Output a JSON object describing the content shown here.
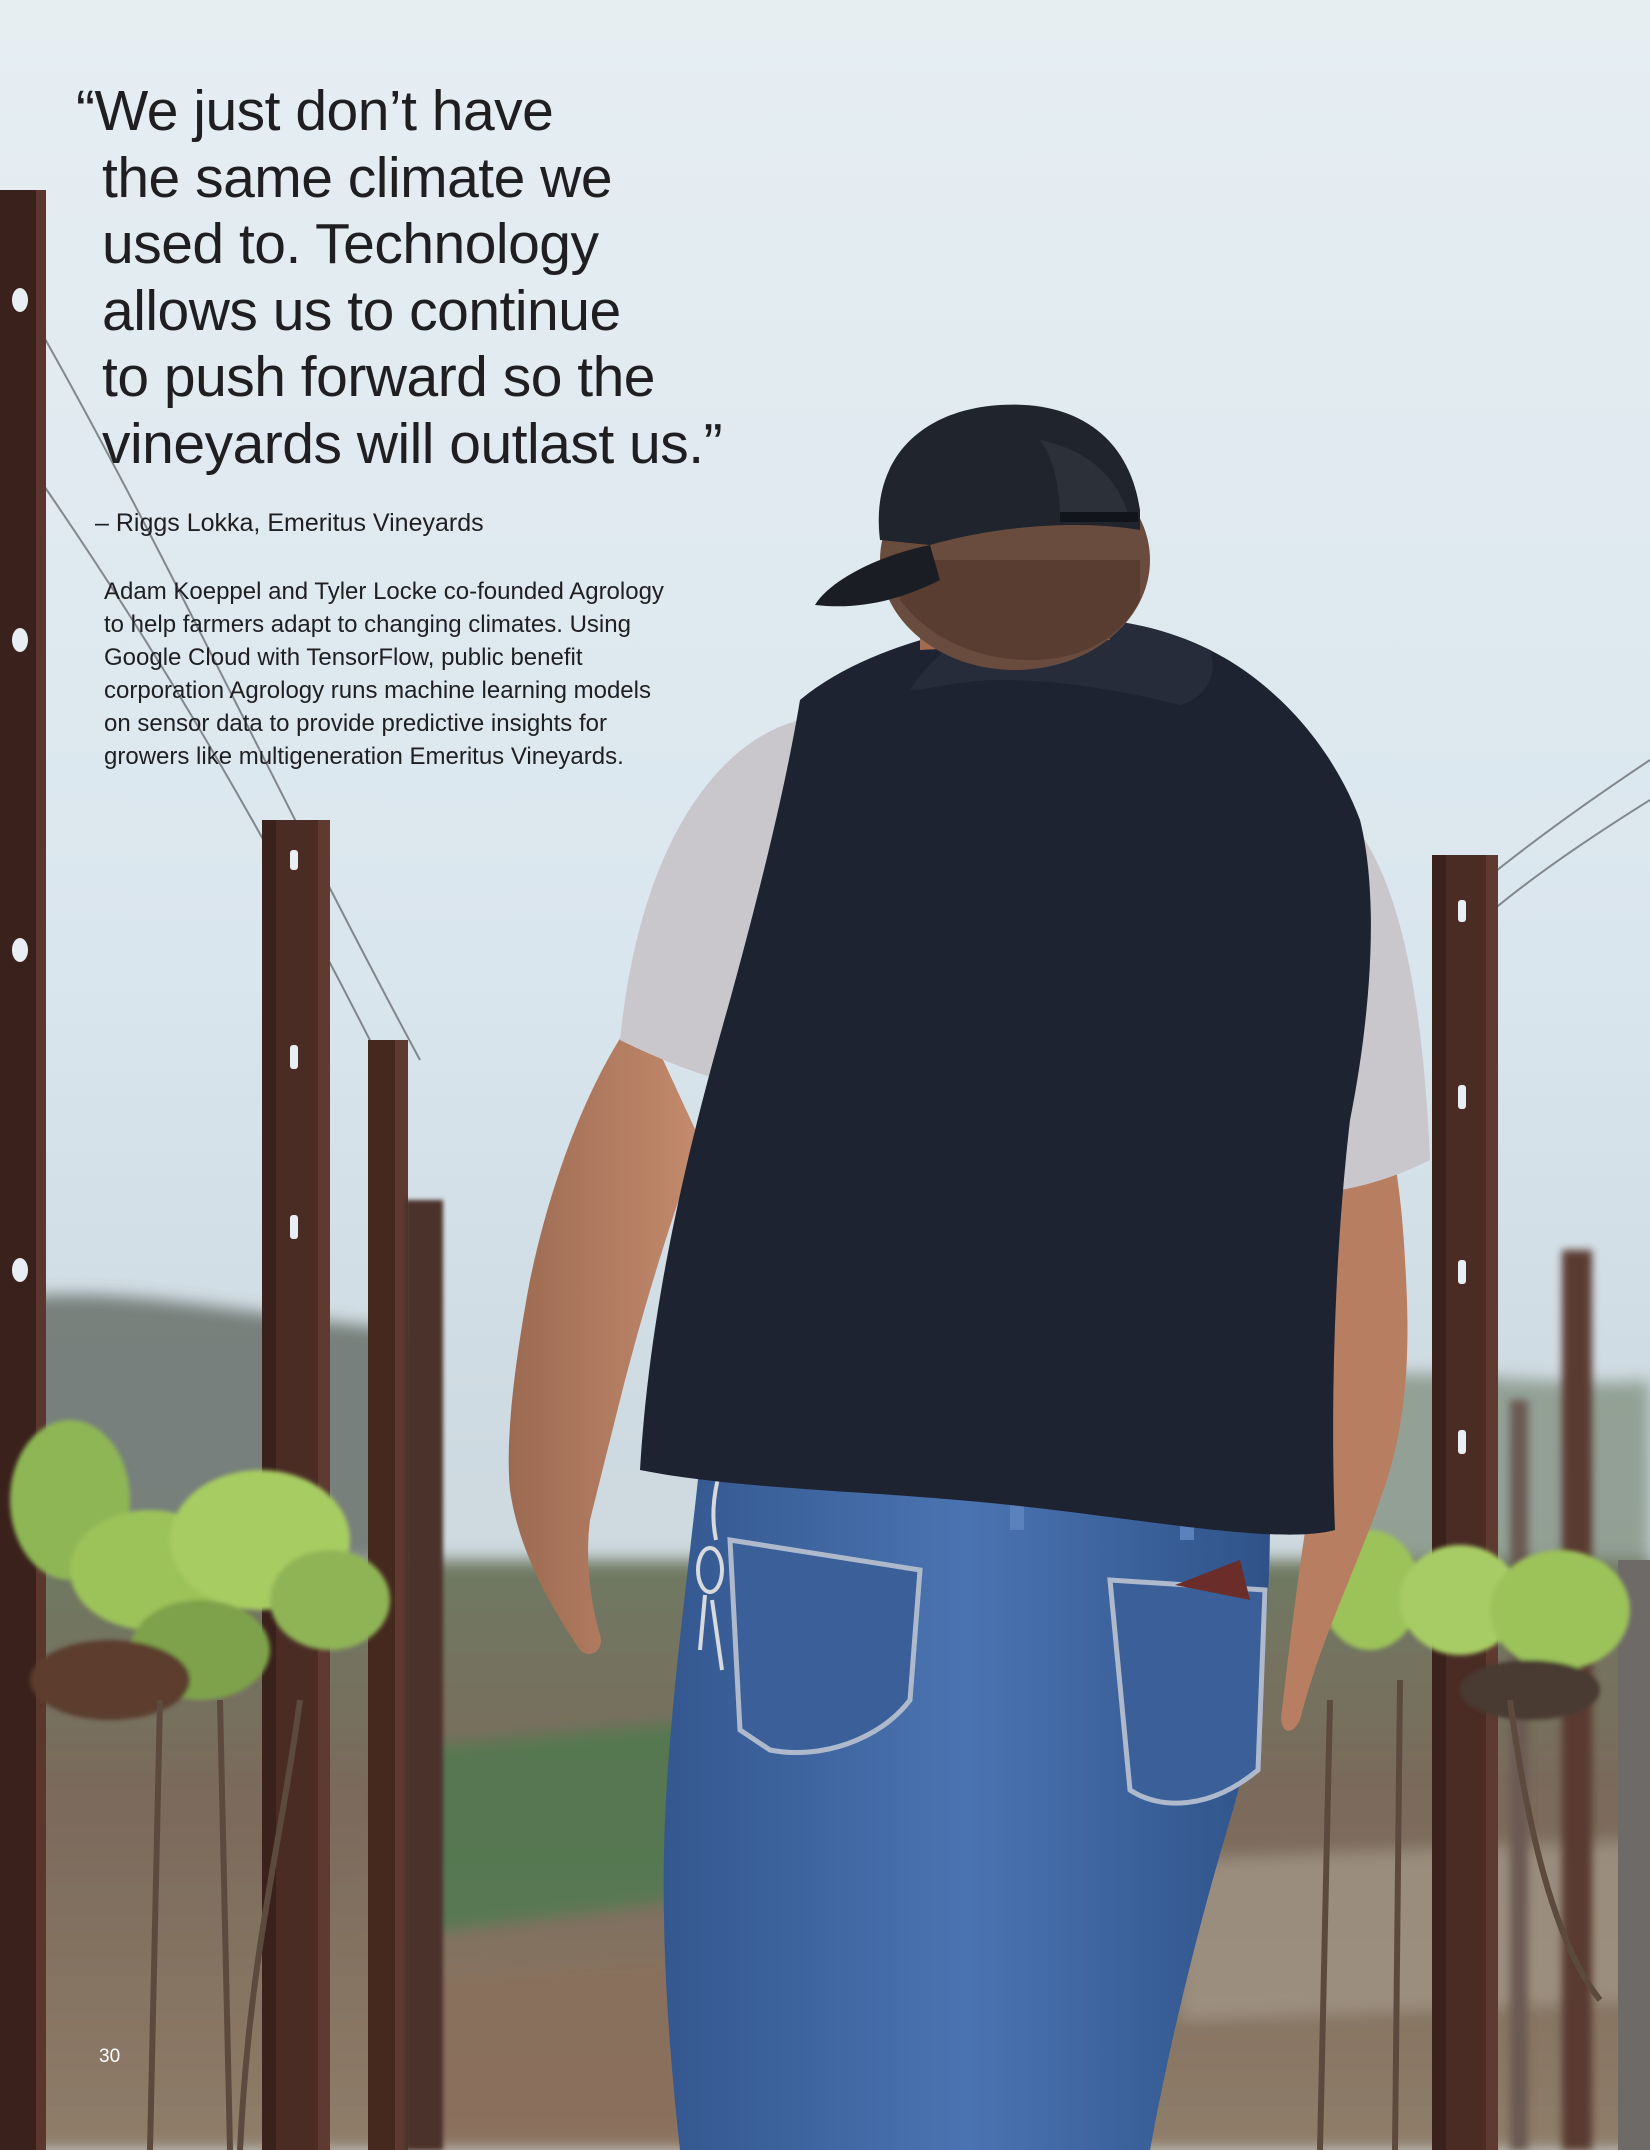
{
  "quote": {
    "lines": [
      "“We just don’t have",
      "the same climate we",
      "used to. Technology",
      "allows us to continue",
      "to push forward so the",
      "vineyards will outlast us.”"
    ]
  },
  "attribution": "– Riggs Lokka, Emeritus Vineyards",
  "body": {
    "lines": [
      "Adam Koeppel and Tyler Locke co-founded Agrology",
      "to help farmers adapt to changing climates. Using",
      "Google Cloud with TensorFlow, public benefit",
      "corporation Agrology runs machine learning models",
      "on sensor data to provide predictive insights for",
      "growers like multigeneration Emeritus Vineyards."
    ]
  },
  "page_number": "30",
  "colors": {
    "sky": "#dfe9ef",
    "text": "#1f1f22",
    "vest": "#1d2330",
    "jeans": "#3f67a3",
    "post": "#4a2c25",
    "foliage": "#9cc25a"
  }
}
